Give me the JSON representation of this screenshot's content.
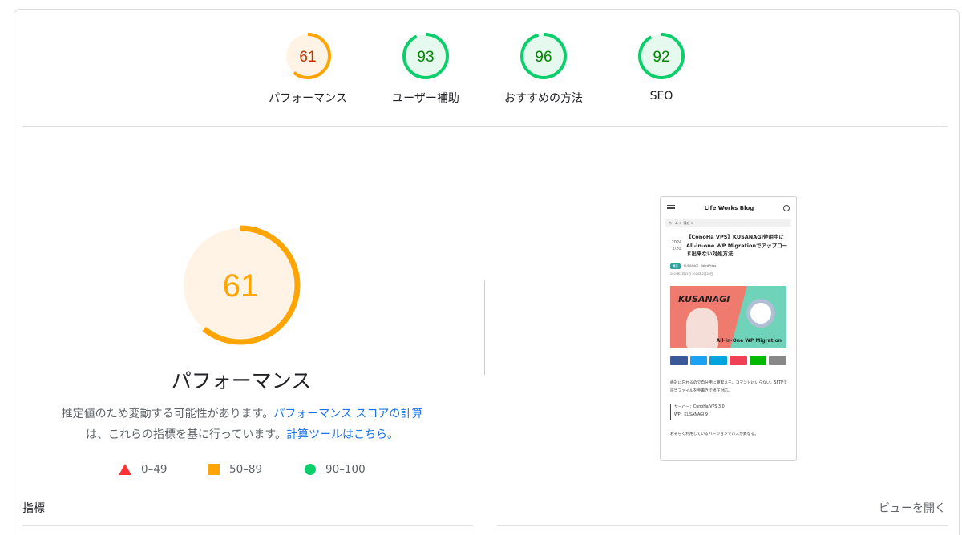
{
  "categories": [
    {
      "score": "61",
      "label": "パフォーマンス",
      "fraction": 0.61,
      "status": "average"
    },
    {
      "score": "93",
      "label": "ユーザー補助",
      "fraction": 0.93,
      "status": "pass"
    },
    {
      "score": "96",
      "label": "おすすめの方法",
      "fraction": 0.96,
      "status": "pass"
    },
    {
      "score": "92",
      "label": "SEO",
      "fraction": 0.92,
      "status": "pass"
    }
  ],
  "colors": {
    "average": "#ffa400",
    "average_bg": "#fff3e6",
    "average_text": "#c33300",
    "pass": "#0cce6b",
    "pass_bg": "#e6f9ee",
    "pass_text": "#008800",
    "fail": "#ff3333"
  },
  "main": {
    "score": "61",
    "fraction": 0.61,
    "title": "パフォーマンス",
    "desc_prefix": "推定値のため変動する可能性があります。",
    "link_score_calc": "パフォーマンス スコアの計算",
    "desc_middle": "は、これらの指標を基に行っています。",
    "link_calculator": "計算ツールはこちら。"
  },
  "legend": [
    {
      "icon": "red-triangle-icon",
      "range": "0–49"
    },
    {
      "icon": "orange-square-icon",
      "range": "50–89"
    },
    {
      "icon": "green-circle-icon",
      "range": "90–100"
    }
  ],
  "thumbnail": {
    "site_title": "Life Works Blog",
    "breadcrumb": "ホーム ＞ 備忘 ＞",
    "date_year": "2024",
    "date_day": "2/20",
    "post_title": "【ConoHa VPS】KUSANAGI使用中にAll-in-one WP Migrationでアップロード出来ない対処方法",
    "tag_category": "備忘",
    "tag_1": "KUSANAGI",
    "tag_2": "WordPress",
    "meta": "2024年2月15日 2024年2月20日",
    "hero_left": "KUSANAGI",
    "hero_right": "All-in-One WP Migration",
    "body_text": "絶対に忘れるので自分用に簡潔メモ。コマンドはいらない。SFTPで該当ファイルを手書きで修正対応。",
    "box_line1": "サーバー：ConoHa VPS 3.0",
    "box_line2": "WP：KUSANAGI 9",
    "footer_text": "おそらく利用しているバージョンでパスが異なる。"
  },
  "metrics_label": "指標",
  "view_toggle": "ビューを開く"
}
